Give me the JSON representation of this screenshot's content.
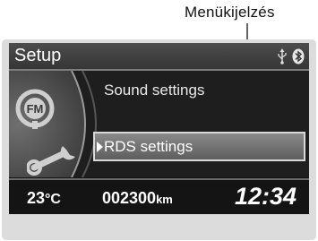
{
  "callout": {
    "label": "Menükijelzés"
  },
  "header": {
    "title": "Setup",
    "icons": [
      "usb-icon",
      "bluetooth-icon"
    ]
  },
  "menu": {
    "items": [
      {
        "label": "Sound settings",
        "selected": false
      },
      {
        "label": "RDS settings",
        "selected": true
      }
    ],
    "side_icons": [
      "fm-radio-icon",
      "wrench-icon"
    ]
  },
  "status": {
    "temperature": "23",
    "temperature_unit": "°C",
    "odometer": "002300",
    "odometer_unit": "km",
    "clock": "12:34"
  },
  "colors": {
    "screen_bg": "#141414",
    "highlight": "#8a8a8a",
    "text": "#ffffff"
  }
}
